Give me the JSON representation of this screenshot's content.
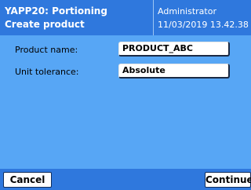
{
  "header": {
    "title_line1": "YAPP20: Portioning",
    "title_line2": "Create product",
    "user": "Administrator",
    "datetime": "11/03/2019 13.42.38"
  },
  "form": {
    "product_name_label": "Product name:",
    "product_name_value": "PRODUCT_ABC",
    "unit_tolerance_label": "Unit tolerance:",
    "unit_tolerance_value": "Absolute"
  },
  "footer": {
    "cancel_label": "Cancel",
    "continue_label": "Continue"
  },
  "colors": {
    "header_bg": "#2f78dd",
    "body_bg": "#57a6f5",
    "footer_bg": "#2f78dd"
  }
}
